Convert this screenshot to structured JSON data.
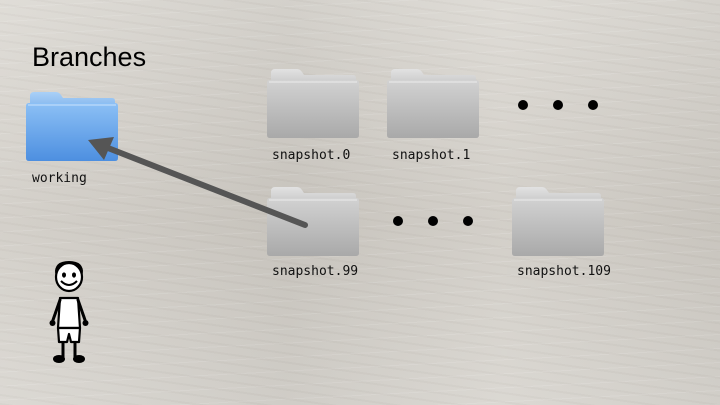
{
  "slide": {
    "title": "Branches",
    "folders": {
      "working": {
        "label": "working",
        "color": "#5b9be6"
      },
      "snapshot_0": {
        "label": "snapshot.0",
        "color": "#bdbdbd"
      },
      "snapshot_1": {
        "label": "snapshot.1",
        "color": "#bdbdbd"
      },
      "snapshot_99": {
        "label": "snapshot.99",
        "color": "#bdbdbd"
      },
      "snapshot_109": {
        "label": "snapshot.109",
        "color": "#bdbdbd"
      }
    },
    "arrow": {
      "from": "snapshot.99",
      "to": "working",
      "color": "#555555"
    },
    "ellipsis_icon": "three-dots",
    "figure_icon": "stick-figure"
  }
}
